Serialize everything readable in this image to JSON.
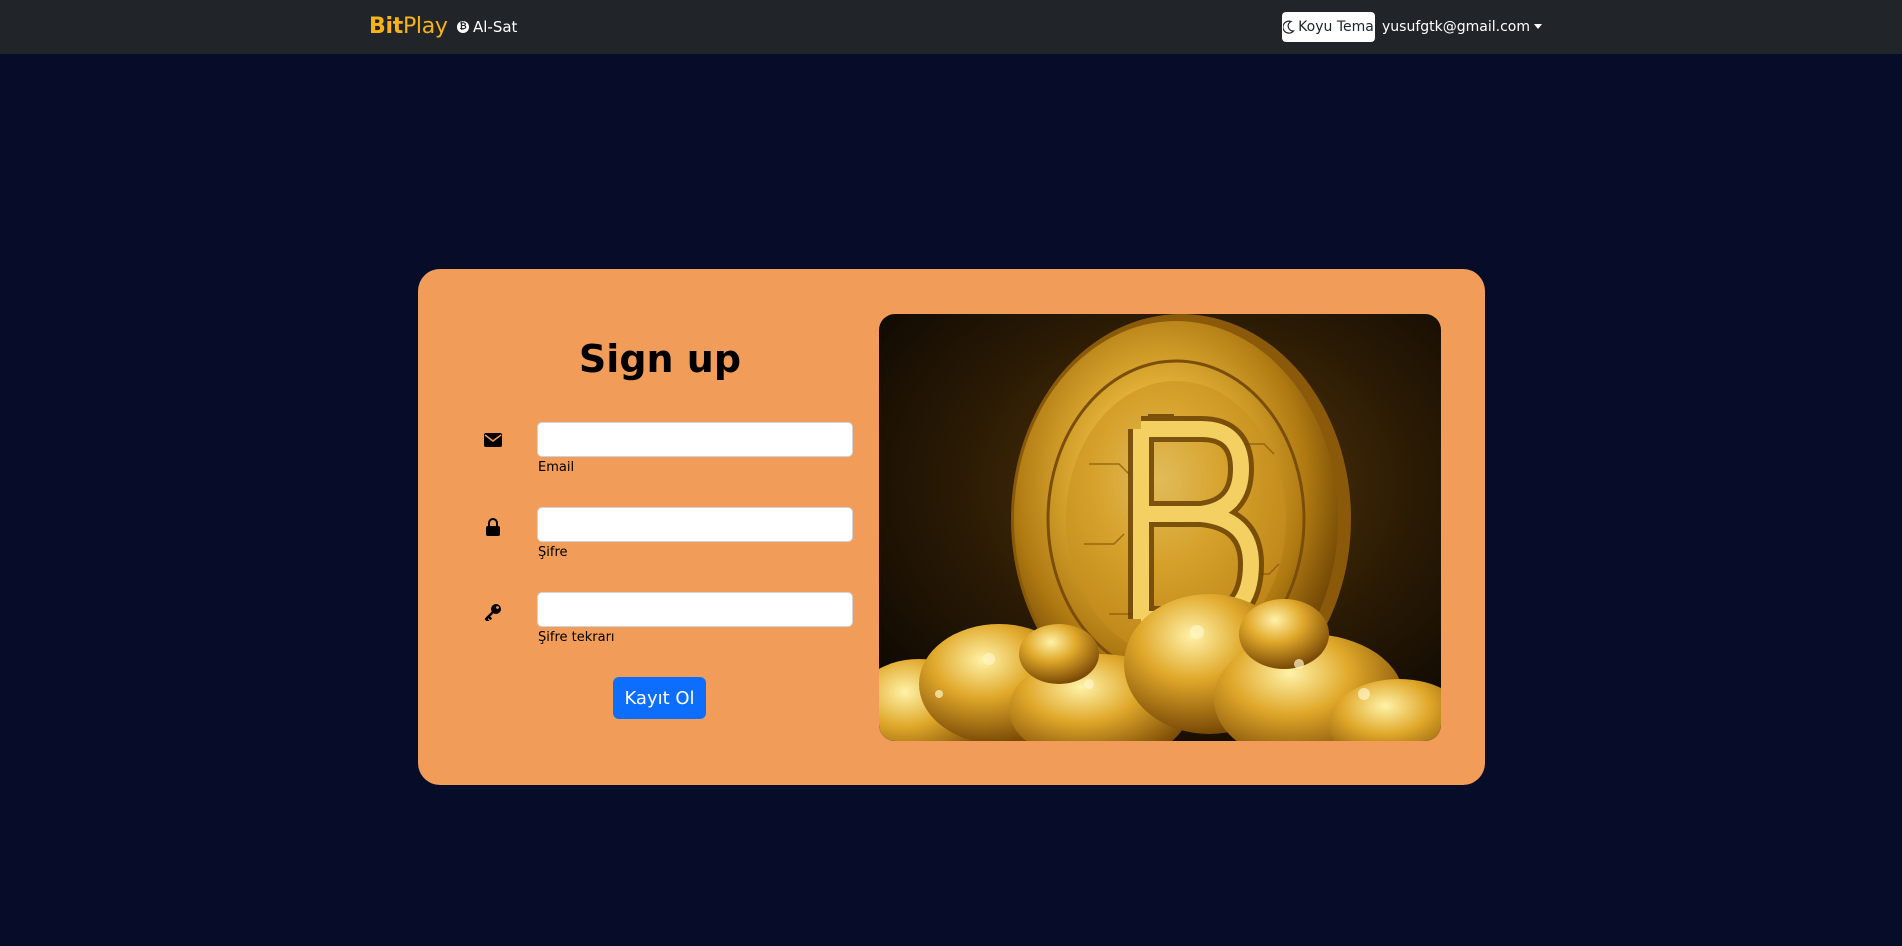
{
  "navbar": {
    "brand_bold": "Bit",
    "brand_light": "Play",
    "trade_link": "Al-Sat",
    "trade_icon": "bitcoin-coin-icon",
    "theme_button": "Koyu Tema",
    "theme_icon": "moon-icon",
    "user_email": "yusufgtk@gmail.com",
    "user_icon": "caret-down-icon"
  },
  "signup": {
    "title": "Sign up",
    "fields": [
      {
        "icon": "envelope-icon",
        "label": "Email",
        "value": ""
      },
      {
        "icon": "lock-icon",
        "label": "Şifre",
        "value": ""
      },
      {
        "icon": "key-icon",
        "label": "Şifre tekrarı",
        "value": ""
      }
    ],
    "submit_label": "Kayıt Ol",
    "image_name": "bitcoin-gold-image"
  },
  "colors": {
    "page_background": "#070d29",
    "navbar_background": "#212529",
    "brand": "#f8b319",
    "card_background": "#f19c58",
    "primary_button": "#0d6efd"
  }
}
